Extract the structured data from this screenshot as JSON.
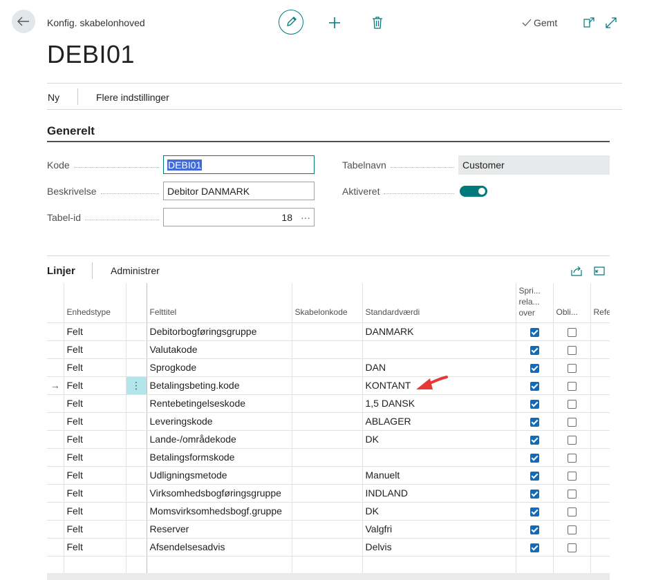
{
  "header": {
    "breadcrumb": "Konfig. skabelonhoved",
    "saved_label": "Gemt",
    "title": "DEBI01"
  },
  "menu": {
    "new_label": "Ny",
    "more_label": "Flere indstillinger"
  },
  "general": {
    "section_title": "Generelt",
    "code_label": "Kode",
    "code_value": "DEBI01",
    "description_label": "Beskrivelse",
    "description_value": "Debitor DANMARK",
    "table_id_label": "Tabel-id",
    "table_id_value": "18",
    "table_id_more": "···",
    "table_name_label": "Tabelnavn",
    "table_name_value": "Customer",
    "enabled_label": "Aktiveret",
    "enabled": true
  },
  "lines": {
    "title": "Linjer",
    "manage_label": "Administrer",
    "columns": {
      "type": "Enhedstype",
      "field_title": "Felttitel",
      "template_code": "Skabelonkode",
      "default_value": "Standardværdi",
      "skip_relation": "Spri... rela... over",
      "mandatory": "Obli...",
      "reference": "Refe"
    },
    "rows": [
      {
        "type": "Felt",
        "field": "Debitorbogføringsgruppe",
        "template": "",
        "default": "DANMARK",
        "skip": true,
        "mandatory": false
      },
      {
        "type": "Felt",
        "field": "Valutakode",
        "template": "",
        "default": "",
        "skip": true,
        "mandatory": false
      },
      {
        "type": "Felt",
        "field": "Sprogkode",
        "template": "",
        "default": "DAN",
        "skip": true,
        "mandatory": false
      },
      {
        "type": "Felt",
        "field": "Betalingsbeting.kode",
        "template": "",
        "default": "KONTANT",
        "skip": true,
        "mandatory": false,
        "selected": true
      },
      {
        "type": "Felt",
        "field": "Rentebetingelseskode",
        "template": "",
        "default": "1,5 DANSK",
        "skip": true,
        "mandatory": false
      },
      {
        "type": "Felt",
        "field": "Leveringskode",
        "template": "",
        "default": "ABLAGER",
        "skip": true,
        "mandatory": false
      },
      {
        "type": "Felt",
        "field": "Lande-/områdekode",
        "template": "",
        "default": "DK",
        "skip": true,
        "mandatory": false
      },
      {
        "type": "Felt",
        "field": "Betalingsformskode",
        "template": "",
        "default": "",
        "skip": true,
        "mandatory": false
      },
      {
        "type": "Felt",
        "field": "Udligningsmetode",
        "template": "",
        "default": "Manuelt",
        "skip": true,
        "mandatory": false
      },
      {
        "type": "Felt",
        "field": "Virksomhedsbogføringsgruppe",
        "template": "",
        "default": "INDLAND",
        "skip": true,
        "mandatory": false
      },
      {
        "type": "Felt",
        "field": "Momsvirksomhedsbogf.gruppe",
        "template": "",
        "default": "DK",
        "skip": true,
        "mandatory": false
      },
      {
        "type": "Felt",
        "field": "Reserver",
        "template": "",
        "default": "Valgfri",
        "skip": true,
        "mandatory": false
      },
      {
        "type": "Felt",
        "field": "Afsendelsesadvis",
        "template": "",
        "default": "Delvis",
        "skip": true,
        "mandatory": false
      }
    ],
    "row_menu_glyph": "⋮",
    "selected_row_arrow": "→"
  },
  "colors": {
    "accent": "#00797d",
    "checkbox": "#0f6cbd",
    "annotation_arrow": "#e53935"
  }
}
